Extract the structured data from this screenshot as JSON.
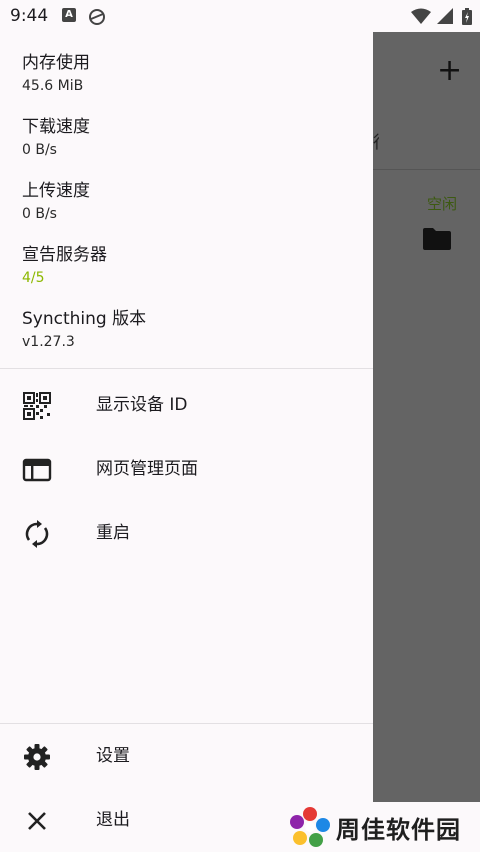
{
  "status_bar": {
    "time": "9:44",
    "icons": [
      "a-badge-icon",
      "sync-icon",
      "wifi-icon",
      "signal-icon",
      "battery-icon"
    ]
  },
  "background_app": {
    "add_icon": "plus-icon",
    "partial_text": "行",
    "idle_status": "空闲",
    "folder_icon": "folder-icon"
  },
  "drawer": {
    "info": [
      {
        "label": "内存使用",
        "value": "45.6 MiB"
      },
      {
        "label": "下载速度",
        "value": "0 B/s"
      },
      {
        "label": "上传速度",
        "value": "0 B/s"
      },
      {
        "label": "宣告服务器",
        "value": "4/5"
      },
      {
        "label": "Syncthing 版本",
        "value": "v1.27.3"
      }
    ],
    "menu": [
      {
        "label": "显示设备 ID",
        "icon": "qr-code-icon"
      },
      {
        "label": "网页管理页面",
        "icon": "web-page-icon"
      },
      {
        "label": "重启",
        "icon": "restart-icon"
      }
    ],
    "bottom_menu": [
      {
        "label": "设置",
        "icon": "gear-icon"
      },
      {
        "label": "退出",
        "icon": "close-icon"
      }
    ]
  },
  "watermark": {
    "text": "周佳软件园"
  },
  "colors": {
    "accent_green": "#8cb800",
    "scrim": "#646464",
    "drawer_bg": "#fcf9fb"
  }
}
